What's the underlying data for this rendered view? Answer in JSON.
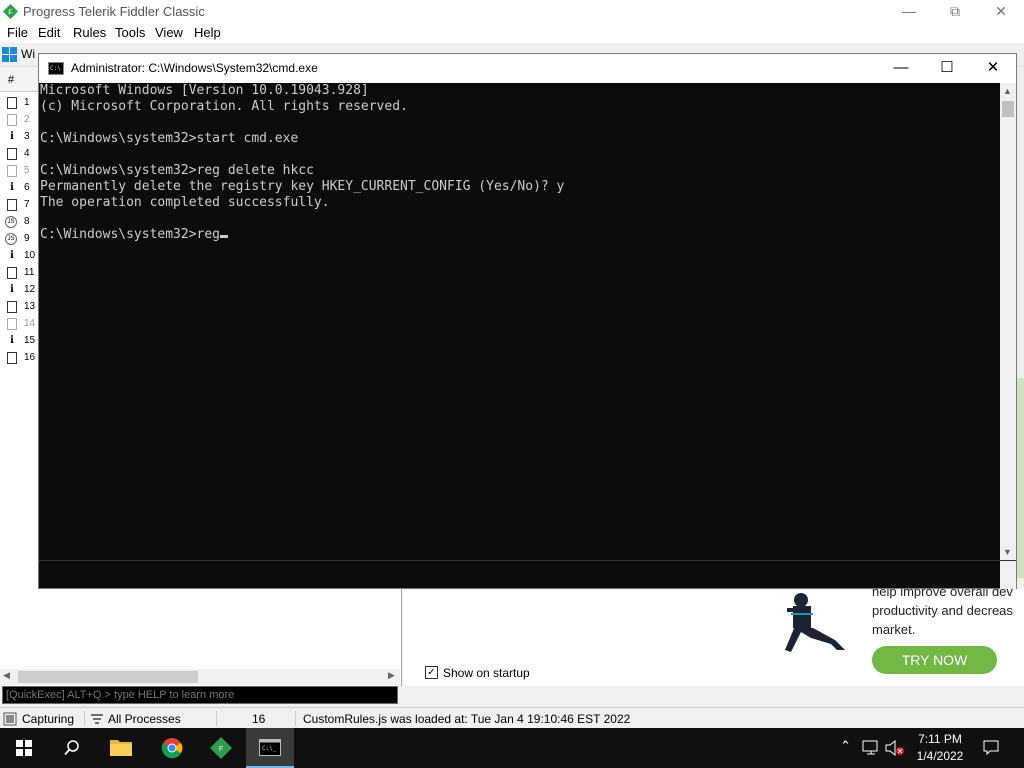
{
  "fiddler": {
    "title": "Progress Telerik Fiddler Classic",
    "menu": [
      "File",
      "Edit",
      "Rules",
      "Tools",
      "View",
      "Help"
    ],
    "toolbar_first": "Wi",
    "sessions_header": "#",
    "sessions": [
      {
        "num": "1",
        "icon": "doc-icon"
      },
      {
        "num": "2",
        "icon": "lock-icon",
        "muted": true
      },
      {
        "num": "3",
        "icon": "info-icon"
      },
      {
        "num": "4",
        "icon": "doc-icon"
      },
      {
        "num": "5",
        "icon": "lock-icon",
        "muted": true
      },
      {
        "num": "6",
        "icon": "info-icon"
      },
      {
        "num": "7",
        "icon": "doc-icon"
      },
      {
        "num": "8",
        "icon": "js-icon"
      },
      {
        "num": "9",
        "icon": "js-icon"
      },
      {
        "num": "10",
        "icon": "info-icon"
      },
      {
        "num": "11",
        "icon": "doc-icon"
      },
      {
        "num": "12",
        "icon": "info-icon"
      },
      {
        "num": "13",
        "icon": "doc-icon"
      },
      {
        "num": "14",
        "icon": "lock-icon",
        "muted": true
      },
      {
        "num": "15",
        "icon": "info-icon"
      },
      {
        "num": "16",
        "icon": "doc-icon"
      }
    ],
    "quickexec_placeholder": "[QuickExec] ALT+Q > type HELP to learn more",
    "promo": {
      "text": "help improve overall dev productivity and decreas market.",
      "cta": "TRY NOW"
    },
    "show_on_startup": "Show on startup",
    "status": {
      "capturing": "Capturing",
      "processes": "All Processes",
      "count": "16",
      "message": "CustomRules.js was loaded at: Tue Jan 4 19:10:46 EST 2022"
    }
  },
  "cmd": {
    "title": "Administrator: C:\\Windows\\System32\\cmd.exe",
    "lines": [
      "Microsoft Windows [Version 10.0.19043.928]",
      "(c) Microsoft Corporation. All rights reserved.",
      "",
      "C:\\Windows\\system32>start cmd.exe",
      "",
      "C:\\Windows\\system32>reg delete hkcc",
      "Permanently delete the registry key HKEY_CURRENT_CONFIG (Yes/No)? y",
      "The operation completed successfully.",
      ""
    ],
    "prompt": "C:\\Windows\\system32>reg"
  },
  "taskbar": {
    "time": "7:11 PM",
    "date": "1/4/2022"
  },
  "colors": {
    "console_bg": "#0c0c0c",
    "console_fg": "#cccccc",
    "cta_green": "#71b944",
    "taskbar_bg": "#101010"
  }
}
